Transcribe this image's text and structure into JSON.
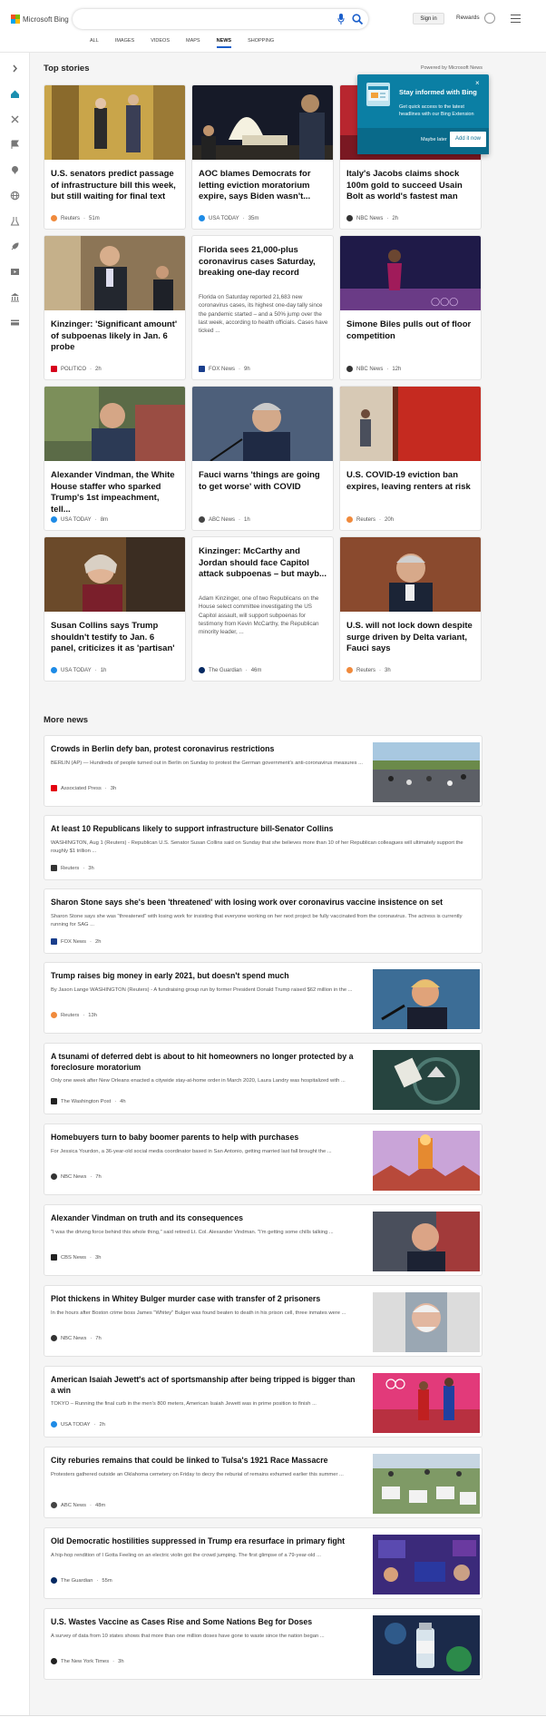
{
  "header": {
    "brand": "Microsoft Bing",
    "signin": "Sign in",
    "rewards": "Rewards",
    "nav_tabs": [
      "ALL",
      "IMAGES",
      "VIDEOS",
      "MAPS",
      "NEWS",
      "SHOPPING"
    ]
  },
  "sidebar_icons": [
    "chevron-right-icon",
    "home-icon",
    "tools-icon",
    "flag-icon",
    "location-pin-icon",
    "globe-icon",
    "science-icon",
    "rocket-icon",
    "video-icon",
    "bank-icon",
    "card-icon"
  ],
  "top": {
    "title": "Top stories",
    "powered": "Powered by Microsoft News"
  },
  "popup": {
    "title": "Stay informed with Bing",
    "body": "Get quick access to the latest headlines with our Bing Extension",
    "later": "Maybe later",
    "add": "Add it now",
    "close": "×"
  },
  "stories": [
    {
      "title": "U.S. senators predict passage of infrastructure bill this week, but still waiting for final text",
      "source": "Reuters",
      "time": "51m",
      "color": "#f08a3c"
    },
    {
      "title": "AOC blames Democrats for letting eviction moratorium expire, says Biden wasn't...",
      "source": "USA TODAY",
      "time": "35m",
      "color": "#1e8be6"
    },
    {
      "title": "Italy's Jacobs claims shock 100m gold to succeed Usain Bolt as world's fastest man",
      "source": "NBC News",
      "time": "2h",
      "color": "#333"
    },
    {
      "title": "Kinzinger: 'Significant amount' of subpoenas likely in Jan. 6 probe",
      "source": "POLITICO",
      "time": "2h",
      "color": "#d6001c"
    },
    {
      "title": "Florida sees 21,000-plus coronavirus cases Saturday, breaking one-day record",
      "snippet": "Florida on Saturday reported 21,683 new coronavirus cases, its highest one-day tally since the pandemic started – and a 50% jump over the last week, according to health officials. Cases have ticked ...",
      "source": "FOX News",
      "time": "9h",
      "color": "#1a3e8c"
    },
    {
      "title": "Simone Biles pulls out of floor competition",
      "source": "NBC News",
      "time": "12h",
      "color": "#333"
    },
    {
      "title": "Alexander Vindman, the White House staffer who sparked Trump's 1st impeachment, tell...",
      "source": "USA TODAY",
      "time": "8m",
      "color": "#1e8be6"
    },
    {
      "title": "Fauci warns 'things are going to get worse' with COVID",
      "source": "ABC News",
      "time": "1h",
      "color": "#444"
    },
    {
      "title": "U.S. COVID-19 eviction ban expires, leaving renters at risk",
      "source": "Reuters",
      "time": "20h",
      "color": "#f08a3c"
    },
    {
      "title": "Susan Collins says Trump shouldn't testify to Jan. 6 panel, criticizes it as 'partisan'",
      "source": "USA TODAY",
      "time": "1h",
      "color": "#1e8be6"
    },
    {
      "title": "Kinzinger: McCarthy and Jordan should face Capitol attack subpoenas – but mayb...",
      "snippet": "Adam Kinzinger, one of two Republicans on the House select committee investigating the US Capitol assault, will support subpoenas for testimony from Kevin McCarthy, the Republican minority leader, ...",
      "source": "The Guardian",
      "time": "46m",
      "color": "#052962"
    },
    {
      "title": "U.S. will not lock down despite surge driven by Delta variant, Fauci says",
      "source": "Reuters",
      "time": "3h",
      "color": "#f08a3c"
    }
  ],
  "more": {
    "title": "More news",
    "items": [
      {
        "title": "Crowds in Berlin defy ban, protest coronavirus restrictions",
        "snippet": "BERLIN (AP) — Hundreds of people turned out in Berlin on Sunday to protest the German government's anti-coronavirus measures ...",
        "source": "Associated Press",
        "time": "3h",
        "color": "#e3000f"
      },
      {
        "title": "At least 10 Republicans likely to support infrastructure bill-Senator Collins",
        "snippet": "WASHINGTON, Aug 1 (Reuters) - Republican U.S. Senator Susan Collins said on Sunday that she believes more than 10 of her Republican colleagues will ultimately support the roughly $1 trillion ...",
        "source": "Reuters",
        "time": "3h",
        "color": "#333"
      },
      {
        "title": "Sharon Stone says she's been 'threatened' with losing work over coronavirus vaccine insistence on set",
        "snippet": "Sharon Stone says she was \"threatened\" with losing work for insisting that everyone working on her next project be fully vaccinated from the coronavirus. The actress is currently running for SAG ...",
        "source": "FOX News",
        "time": "2h",
        "color": "#1a3e8c"
      },
      {
        "title": "Trump raises big money in early 2021, but doesn't spend much",
        "snippet": "By Jason Lange WASHINGTON (Reuters) - A fundraising group run by former President Donald Trump raised $62 million in the ...",
        "source": "Reuters",
        "time": "13h",
        "color": "#f08a3c"
      },
      {
        "title": "A tsunami of deferred debt is about to hit homeowners no longer protected by a foreclosure moratorium",
        "snippet": "Only one week after New Orleans enacted a citywide stay-at-home order in March 2020, Laura Landry was hospitalized with ...",
        "source": "The Washington Post",
        "time": "4h",
        "color": "#222"
      },
      {
        "title": "Homebuyers turn to baby boomer parents to help with purchases",
        "snippet": "For Jessica Yourdon, a 36-year-old social media coordinator based in San Antonio, getting married last fall brought the ...",
        "source": "NBC News",
        "time": "7h",
        "color": "#333"
      },
      {
        "title": "Alexander Vindman on truth and its consequences",
        "snippet": "\"I was the driving force behind this whole thing,\" said retired Lt. Col. Alexander Vindman. \"I'm getting some chills talking ...",
        "source": "CBS News",
        "time": "3h",
        "color": "#222"
      },
      {
        "title": "Plot thickens in Whitey Bulger murder case with transfer of 2 prisoners",
        "snippet": "In the hours after Boston crime boss James \"Whitey\" Bulger was found beaten to death in his prison cell, three inmates were ...",
        "source": "NBC News",
        "time": "7h",
        "color": "#333"
      },
      {
        "title": "American Isaiah Jewett's act of sportsmanship after being tripped is bigger than a win",
        "snippet": "TOKYO – Running the final curb in the men's 800 meters, American Isaiah Jewett was in prime position to finish ...",
        "source": "USA TODAY",
        "time": "2h",
        "color": "#1e8be6"
      },
      {
        "title": "City reburies remains that could be linked to Tulsa's 1921 Race Massacre",
        "snippet": "Protesters gathered outside an Oklahoma cemetery on Friday to decry the reburial of remains exhumed earlier this summer ...",
        "source": "ABC News",
        "time": "48m",
        "color": "#444"
      },
      {
        "title": "Old Democratic hostilities suppressed in Trump era resurface in primary fight",
        "snippet": "A hip-hop rendition of I Gotta Feeling on an electric violin got the crowd jumping. The first glimpse of a 79-year-old ...",
        "source": "The Guardian",
        "time": "55m",
        "color": "#052962"
      },
      {
        "title": "U.S. Wastes Vaccine as Cases Rise and Some Nations Beg for Doses",
        "snippet": "A survey of data from 10 states shows that more than one million doses have gone to waste since the nation began ...",
        "source": "The New York Times",
        "time": "3h",
        "color": "#222"
      }
    ]
  },
  "colors": {
    "accent": "#1b5fcb",
    "popup": "#0b7fa4"
  }
}
